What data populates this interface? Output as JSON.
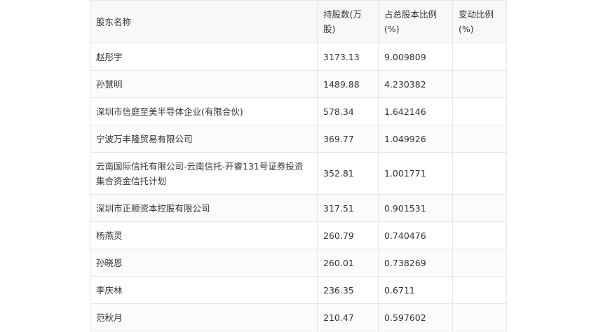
{
  "table": {
    "headers": [
      "股东名称",
      "持股数(万股)",
      "占总股本比例(%)",
      "变动比例(%)"
    ],
    "rows": [
      {
        "name": "赵彤宇",
        "shares": "3173.13",
        "ratio": "9.009809",
        "change": ""
      },
      {
        "name": "孙慧明",
        "shares": "1489.88",
        "ratio": "4.230382",
        "change": ""
      },
      {
        "name": "深圳市信庭至美半导体企业(有限合伙)",
        "shares": "578.34",
        "ratio": "1.642146",
        "change": ""
      },
      {
        "name": "宁波万丰隆贸易有限公司",
        "shares": "369.77",
        "ratio": "1.049926",
        "change": ""
      },
      {
        "name": "云南国际信托有限公司-云南信托-开睿131号证券投资集合资金信托计划",
        "shares": "352.81",
        "ratio": "1.001771",
        "change": ""
      },
      {
        "name": "深圳市正顺资本控股有限公司",
        "shares": "317.51",
        "ratio": "0.901531",
        "change": ""
      },
      {
        "name": "杨燕灵",
        "shares": "260.79",
        "ratio": "0.740476",
        "change": ""
      },
      {
        "name": "孙晓恩",
        "shares": "260.01",
        "ratio": "0.738269",
        "change": ""
      },
      {
        "name": "李庆林",
        "shares": "236.35",
        "ratio": "0.6711",
        "change": ""
      },
      {
        "name": "范秋月",
        "shares": "210.47",
        "ratio": "0.597602",
        "change": ""
      }
    ]
  }
}
